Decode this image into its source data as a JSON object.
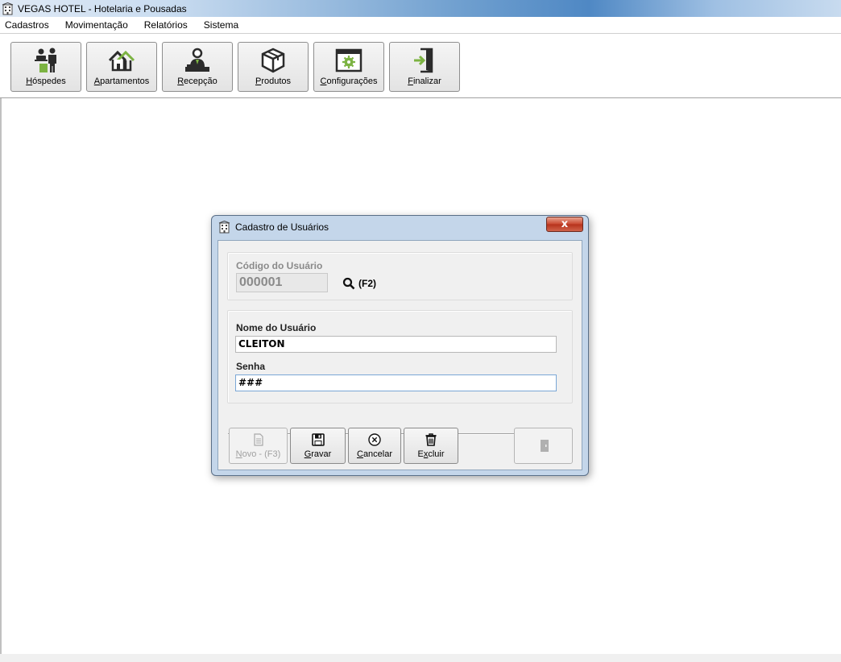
{
  "window": {
    "title": "VEGAS HOTEL - Hotelaria e Pousadas"
  },
  "menu": {
    "items": [
      {
        "label": "Cadastros"
      },
      {
        "label": "Movimentação"
      },
      {
        "label": "Relatórios"
      },
      {
        "label": "Sistema"
      }
    ]
  },
  "toolbar": {
    "buttons": [
      {
        "key": "H",
        "rest": "óspedes",
        "icon": "guests-icon"
      },
      {
        "key": "A",
        "rest": "partamentos",
        "icon": "houses-icon"
      },
      {
        "key": "R",
        "rest": "ecepção",
        "icon": "reception-icon"
      },
      {
        "key": "P",
        "rest": "rodutos",
        "icon": "box-icon"
      },
      {
        "key": "C",
        "rest": "onfigurações",
        "icon": "settings-window-icon"
      },
      {
        "key": "F",
        "rest": "inalizar",
        "icon": "exit-door-icon"
      }
    ]
  },
  "dialog": {
    "title": "Cadastro de Usuários",
    "close_glyph": "x",
    "code_label": "Código do Usuário",
    "code_value": "000001",
    "search_hint": "(F2)",
    "name_label": "Nome do Usuário",
    "name_value": "CLEITON",
    "password_label": "Senha",
    "password_value": "###",
    "buttons": {
      "novo": {
        "key": "N",
        "rest": "ovo - (F3)"
      },
      "gravar": {
        "key": "G",
        "rest": "ravar"
      },
      "cancelar": {
        "key": "C",
        "rest": "ancelar"
      },
      "excluir": {
        "pre": "E",
        "key": "x",
        "rest": "cluir"
      }
    }
  },
  "colors": {
    "accent_green": "#7cb342",
    "icon_dark": "#2b2b2b",
    "dialog_frame": "#c4d6ea",
    "close_red": "#c8452c"
  }
}
